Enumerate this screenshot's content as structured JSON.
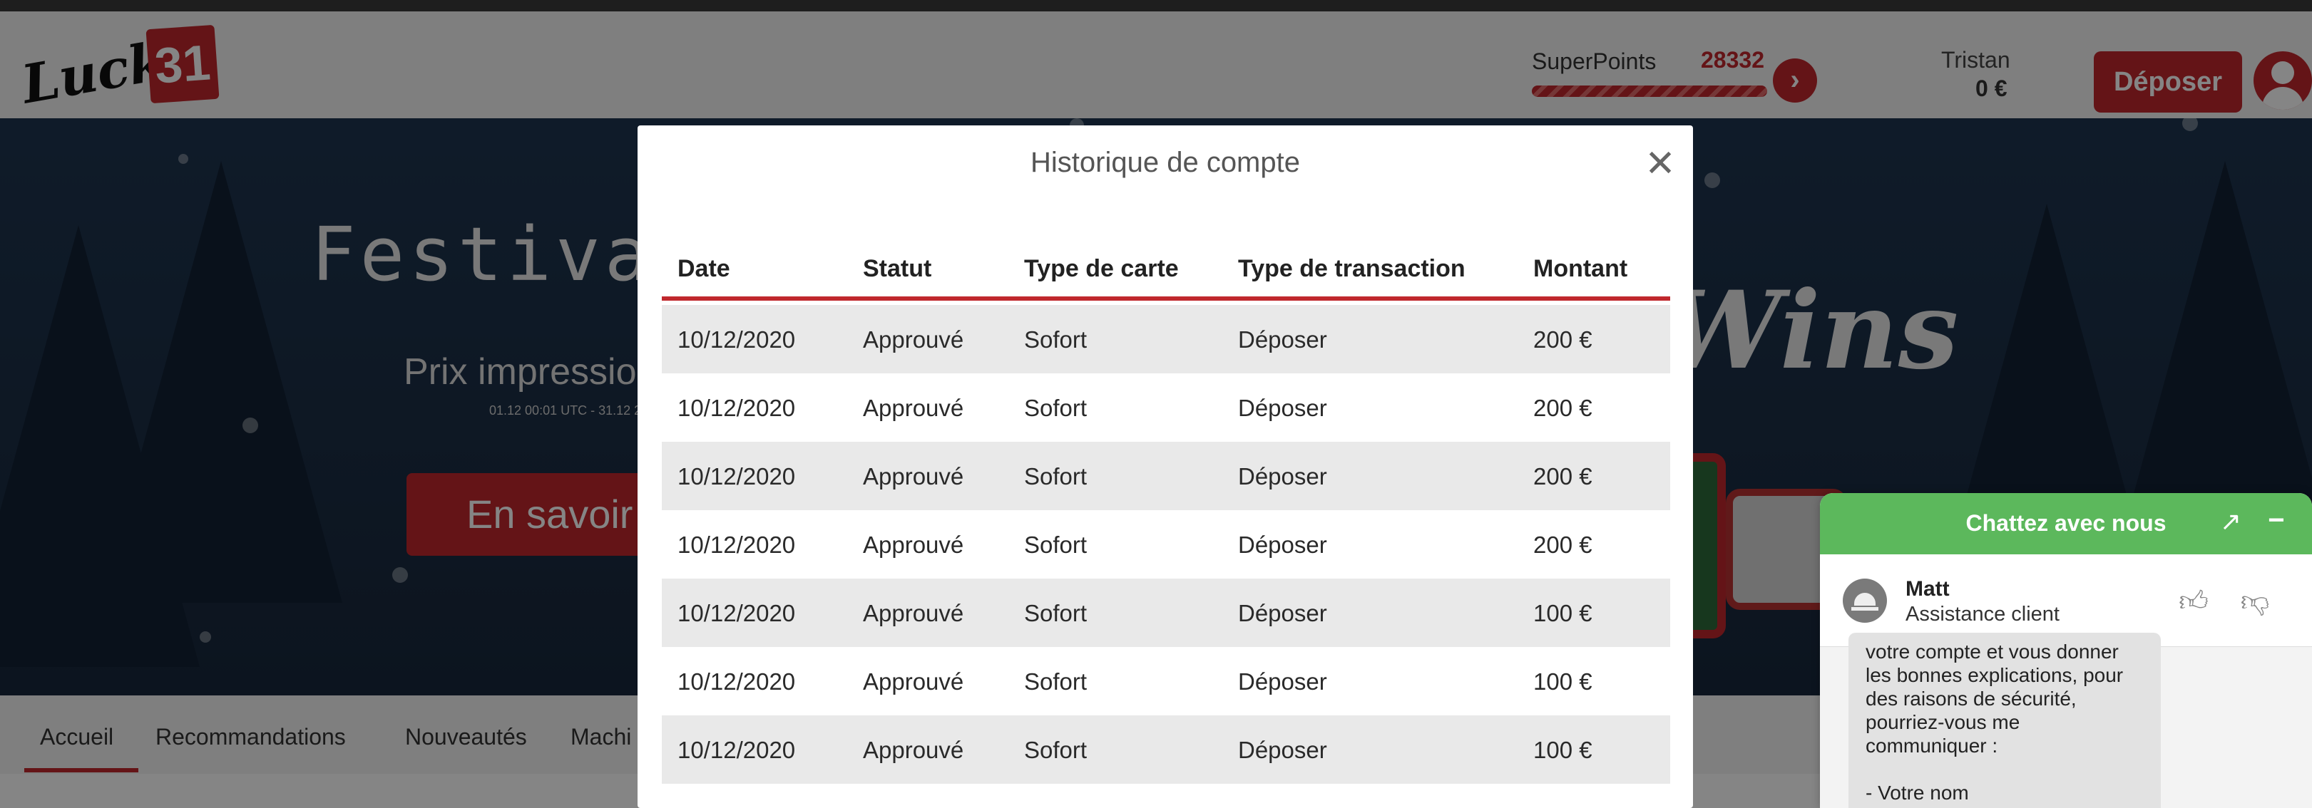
{
  "header": {
    "logo_word": "Lucky",
    "logo_number": "31",
    "superpoints_label": "SuperPoints",
    "superpoints_value": "28332",
    "user_name": "Tristan",
    "user_balance": "0 €",
    "deposit_label": "Déposer"
  },
  "hero": {
    "title": "Festival o",
    "subtitle": "Prix impressio",
    "small_text": "01.12 00:01 UTC - 31.12 2",
    "button_label": "En savoir",
    "wins_text": "Wins"
  },
  "nav": {
    "tabs": [
      "Accueil",
      "Recommandations",
      "Nouveautés",
      "Machi"
    ]
  },
  "modal": {
    "title": "Historique de compte",
    "close_icon": "close-icon",
    "columns": [
      "Date",
      "Statut",
      "Type de carte",
      "Type de transaction",
      "Montant"
    ],
    "rows": [
      [
        "10/12/2020",
        "Approuvé",
        "Sofort",
        "Déposer",
        "200 €"
      ],
      [
        "10/12/2020",
        "Approuvé",
        "Sofort",
        "Déposer",
        "200 €"
      ],
      [
        "10/12/2020",
        "Approuvé",
        "Sofort",
        "Déposer",
        "200 €"
      ],
      [
        "10/12/2020",
        "Approuvé",
        "Sofort",
        "Déposer",
        "200 €"
      ],
      [
        "10/12/2020",
        "Approuvé",
        "Sofort",
        "Déposer",
        "100 €"
      ],
      [
        "10/12/2020",
        "Approuvé",
        "Sofort",
        "Déposer",
        "100 €"
      ],
      [
        "10/12/2020",
        "Approuvé",
        "Sofort",
        "Déposer",
        "100 €"
      ]
    ]
  },
  "chat": {
    "title": "Chattez avec nous",
    "agent_name": "Matt",
    "agent_role": "Assistance client",
    "message": "votre compte et vous donner\nles bonnes explications, pour\ndes raisons de sécurité,\npourriez-vous me\ncommuniquer :\n\n- Votre nom\n- Votre prénom"
  },
  "colors": {
    "brand_red": "#c0282d",
    "chat_green": "#5cb85c"
  }
}
